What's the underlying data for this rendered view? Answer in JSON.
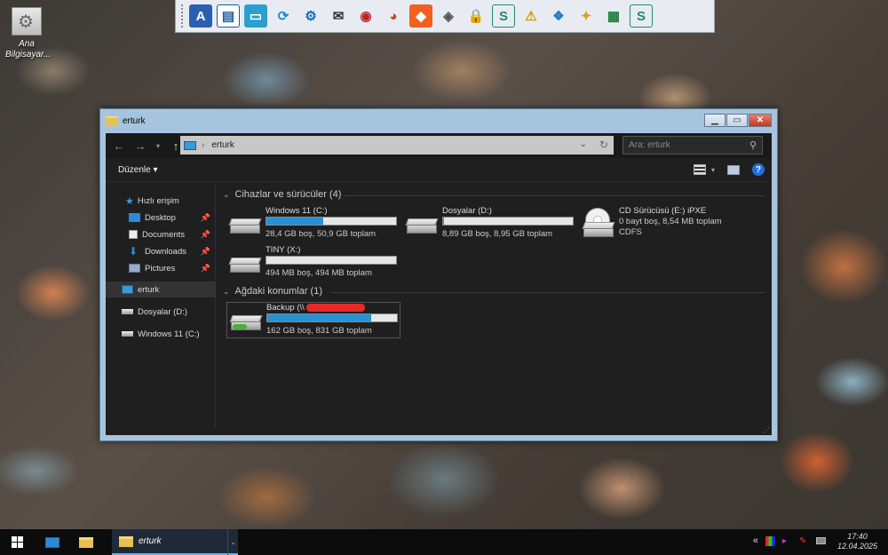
{
  "desktop": {
    "icon_label": "Ana Bilgisayar..."
  },
  "launcher": {
    "items": [
      "A",
      "▤",
      "▭",
      "⟳",
      "⚙",
      "✉",
      "◉",
      "◕",
      "◆",
      "◈",
      "🔒",
      "S",
      "⚠",
      "❖",
      "✦",
      "▦",
      "S"
    ]
  },
  "window": {
    "title": "erturk",
    "address": "erturk",
    "search_placeholder": "Ara: erturk",
    "organize": "Düzenle",
    "sidebar": {
      "quick_access": "Hızlı erişim",
      "desktop": "Desktop",
      "documents": "Documents",
      "downloads": "Downloads",
      "pictures": "Pictures",
      "this_pc": "erturk",
      "drive_d": "Dosyalar (D:)",
      "drive_c": "Windows 11 (C:)"
    },
    "groups": {
      "devices": "Cihazlar ve sürücüler (4)",
      "network": "Ağdaki konumlar (1)"
    },
    "drives": {
      "c": {
        "name": "Windows 11 (C:)",
        "info": "28,4 GB boş, 50,9 GB toplam",
        "used_fraction": 0.44
      },
      "d": {
        "name": "Dosyalar (D:)",
        "info": "8,89 GB boş, 8,95 GB toplam",
        "used_fraction": 0.01
      },
      "e": {
        "name": "CD Sürücüsü (E:) iPXE",
        "info": "0 bayt boş, 8,54 MB toplam",
        "fs": "CDFS"
      },
      "x": {
        "name": "TINY (X:)",
        "info": "494 MB boş, 494 MB toplam",
        "used_fraction": 0.0
      },
      "backup": {
        "name": "Backup (\\\\",
        "info": "162 GB boş, 831 GB toplam",
        "used_fraction": 0.8
      }
    }
  },
  "taskbar": {
    "task_label": "erturk",
    "time": "17:40",
    "date": "12.04.2025",
    "tray_chevron": "«"
  }
}
